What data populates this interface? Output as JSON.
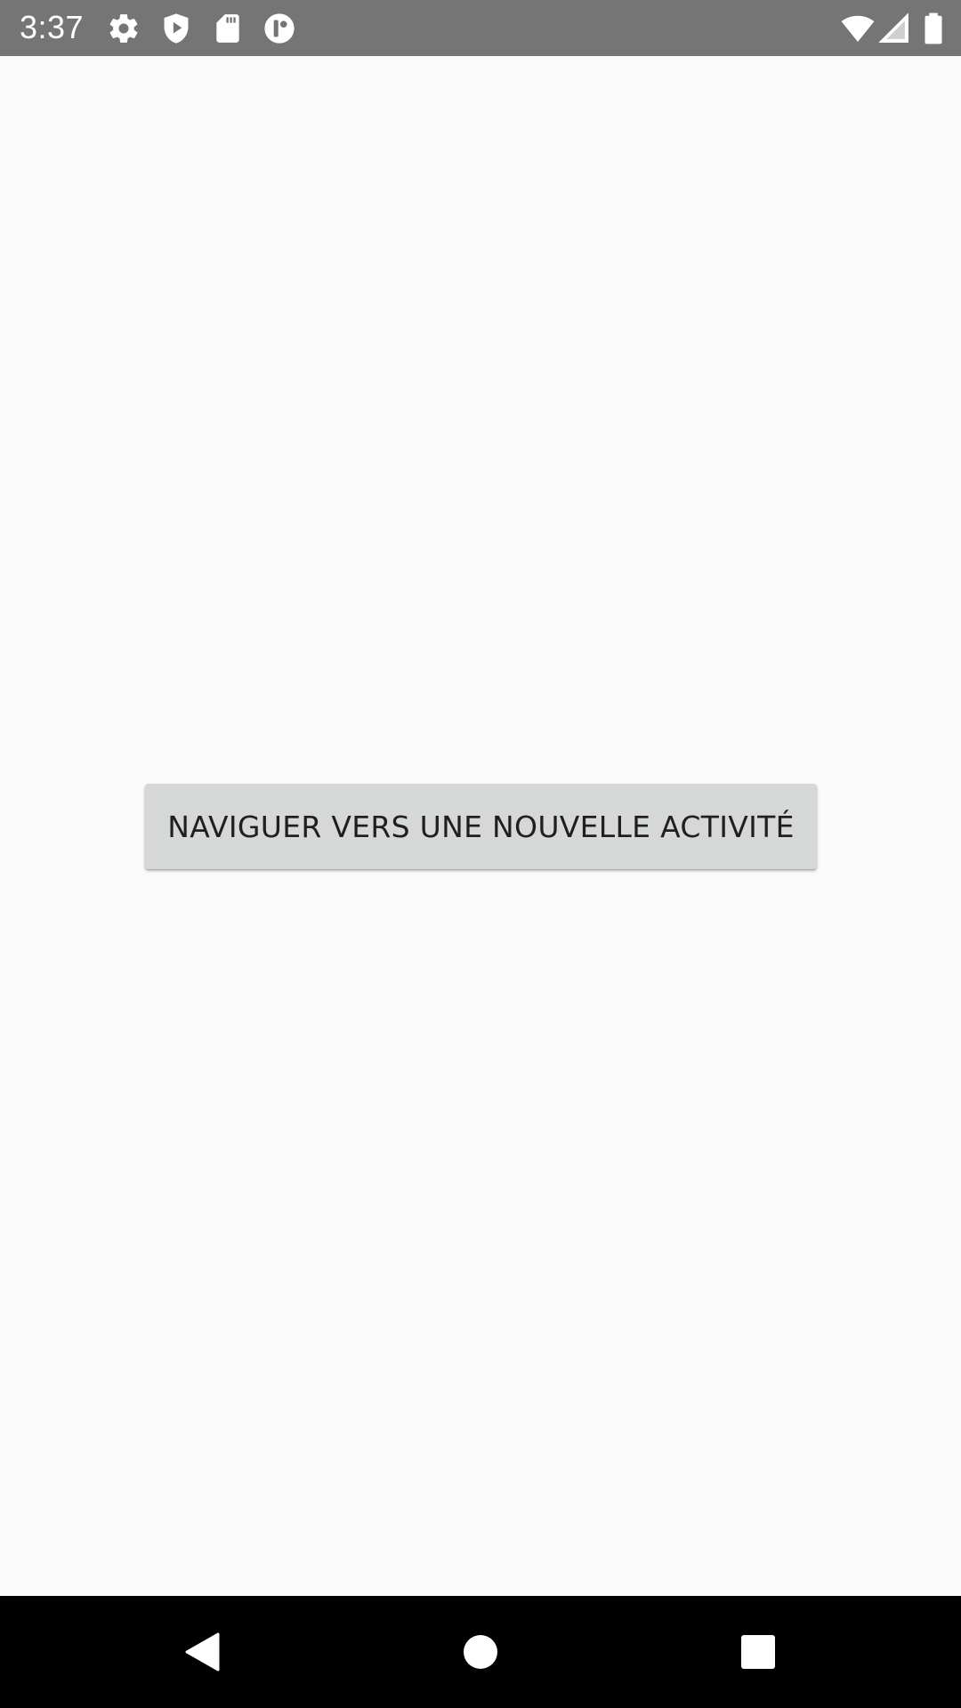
{
  "status_bar": {
    "time": "3:37",
    "left_icons": [
      "gear-icon",
      "shield-icon",
      "sd-card-icon",
      "app-circle-icon"
    ],
    "right_icons": [
      "wifi-icon",
      "cell-signal-icon",
      "battery-icon"
    ],
    "background_color": "#757575"
  },
  "main": {
    "button_label": "NAVIGUER VERS UNE NOUVELLE ACTIVITÉ",
    "background_color": "#fafafa",
    "button_color": "#d6d7d7"
  },
  "navigation_bar": {
    "keys": [
      "back-icon",
      "home-icon",
      "recents-icon"
    ],
    "background_color": "#000000"
  }
}
